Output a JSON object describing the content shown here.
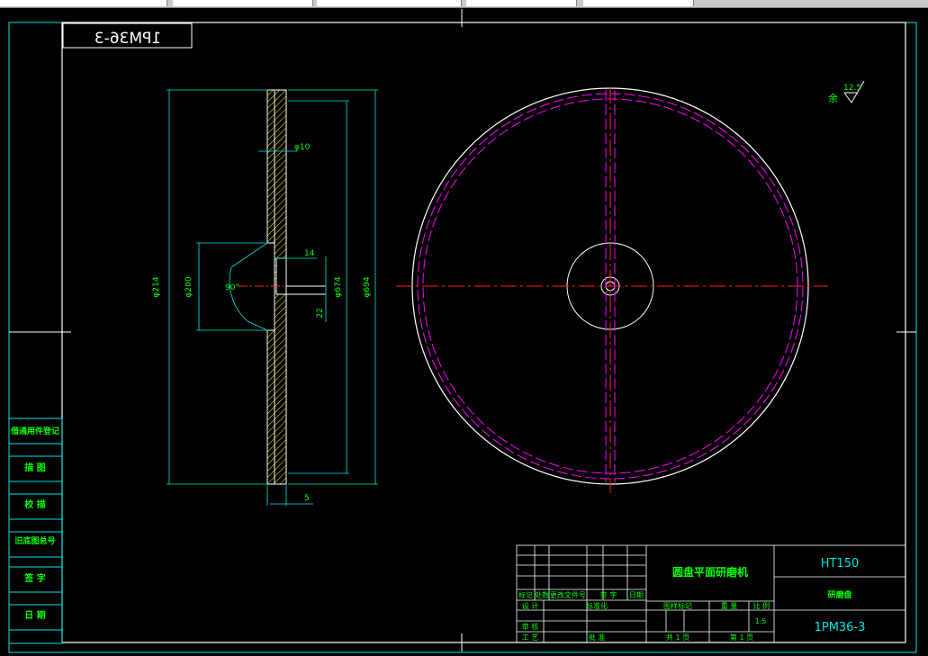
{
  "drawing": {
    "code_mirrored": "1PM36-3",
    "roughness": "12.5",
    "roughness_prefix": "余",
    "dims": {
      "d214": "φ214",
      "d200": "φ200",
      "d174": "φ674",
      "d194": "φ694",
      "d10": "φ10",
      "angle": "90°",
      "w14": "14",
      "w22": "22",
      "w5": "5"
    }
  },
  "left_sidebar": {
    "rows": [
      "借通用件登记",
      "描  图",
      "校  描",
      "旧底图总号",
      "签  字",
      "日  期"
    ]
  },
  "title_block": {
    "machine_name": "圆盘平面研磨机",
    "material": "HT150",
    "part_name": "研磨盘",
    "drawing_no": "1PM36-3",
    "scale": "1:5",
    "labels": {
      "mark": "标记",
      "count": "处数",
      "change_doc": "更改文件号",
      "sign": "签 字",
      "date": "日期",
      "design": "设 计",
      "standardize": "标准化",
      "stage_mark": "图样标记",
      "weight": "重 量",
      "scale_label": "比 例",
      "review": "审 核",
      "process": "工 艺",
      "approve": "批 准",
      "sheets_total": "共 1 页",
      "sheet_no": "第 1 页"
    }
  },
  "colors": {
    "frame": "#00e5e5",
    "text": "#00ff00",
    "part": "#ffffff",
    "centerline": "#ff2020",
    "hidden": "#ff00ff",
    "hatch": "#ffff00"
  }
}
